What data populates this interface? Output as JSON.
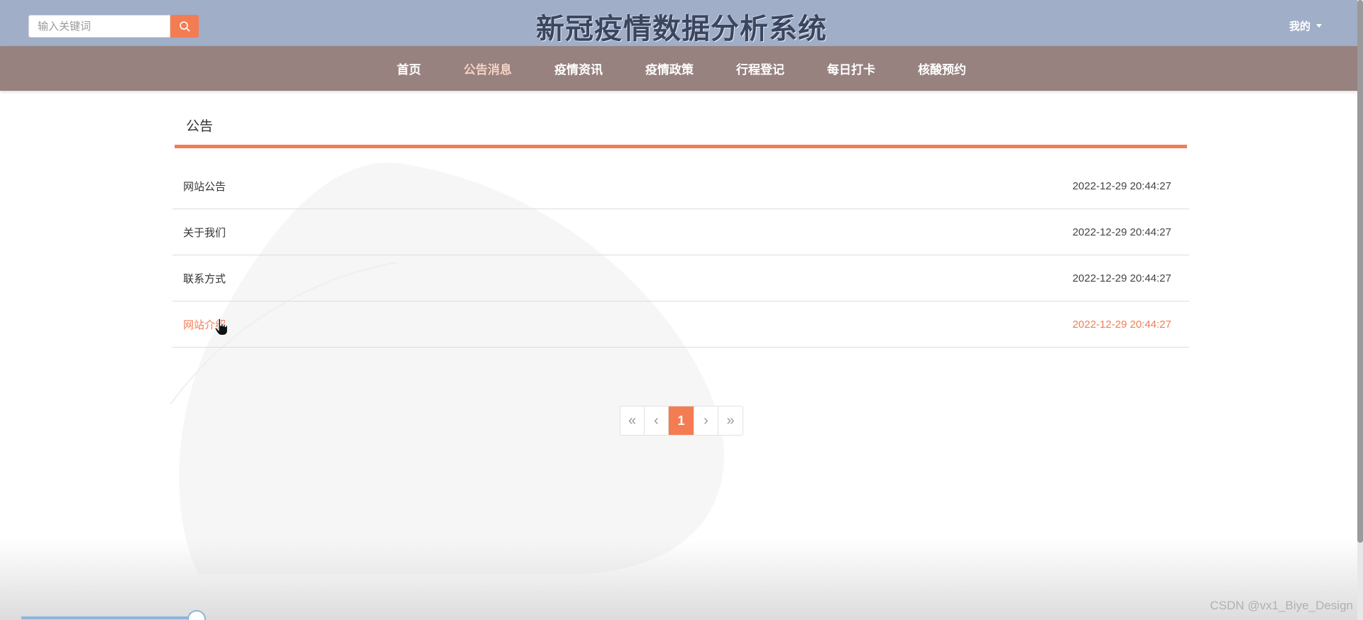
{
  "header": {
    "title": "新冠疫情数据分析系统",
    "search_placeholder": "输入关键词",
    "user_menu_label": "我的"
  },
  "nav": {
    "items": [
      "首页",
      "公告消息",
      "疫情资讯",
      "疫情政策",
      "行程登记",
      "每日打卡",
      "核酸预约"
    ],
    "active_index": 1
  },
  "section": {
    "title": "公告"
  },
  "notices": [
    {
      "title": "网站公告",
      "date": "2022-12-29 20:44:27"
    },
    {
      "title": "关于我们",
      "date": "2022-12-29 20:44:27"
    },
    {
      "title": "联系方式",
      "date": "2022-12-29 20:44:27"
    },
    {
      "title": "网站介绍",
      "date": "2022-12-29 20:44:27"
    }
  ],
  "pagination": {
    "first": "«",
    "prev": "‹",
    "current": "1",
    "next": "›",
    "last": "»"
  },
  "watermark": "CSDN @vx1_Biye_Design",
  "colors": {
    "accent": "#f47c52",
    "header_bg": "#a0aec8",
    "nav_bg": "#978280"
  }
}
